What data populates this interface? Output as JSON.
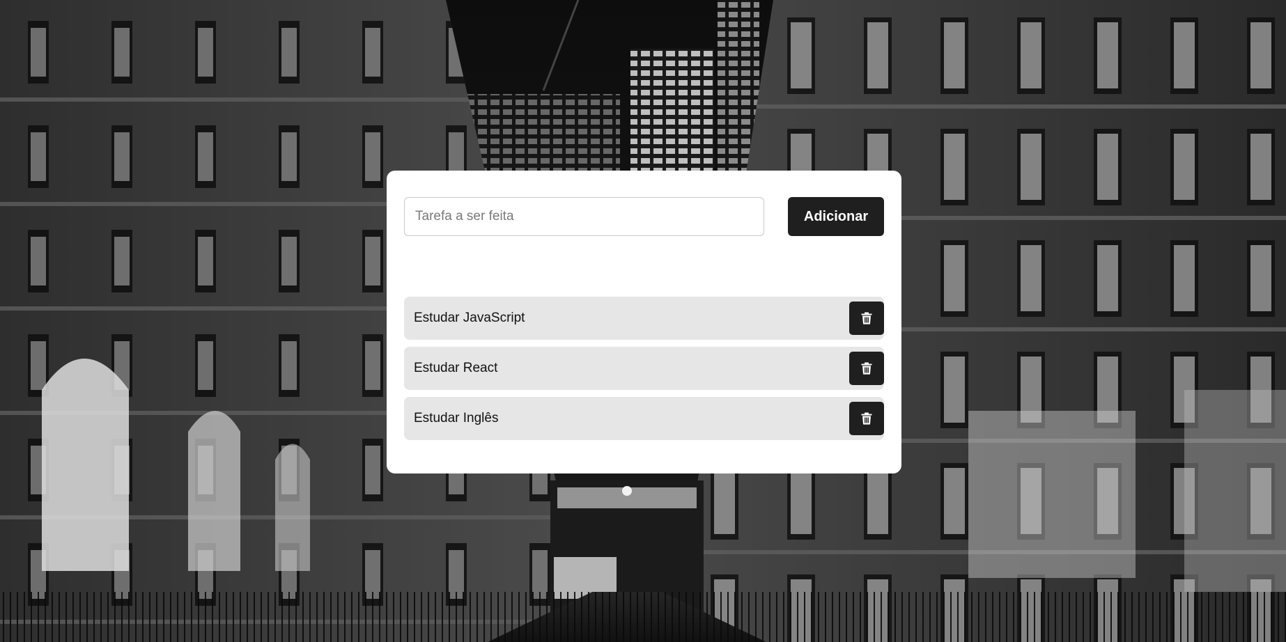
{
  "form": {
    "placeholder": "Tarefa a ser feita",
    "value": "",
    "add_label": "Adicionar"
  },
  "tasks": [
    {
      "label": "Estudar JavaScript",
      "delete_icon": "trash-icon"
    },
    {
      "label": "Estudar React",
      "delete_icon": "trash-icon"
    },
    {
      "label": "Estudar Inglês",
      "delete_icon": "trash-icon"
    }
  ],
  "colors": {
    "button_bg": "#1f1f1f",
    "task_bg": "#e6e6e6",
    "card_bg": "#ffffff"
  }
}
